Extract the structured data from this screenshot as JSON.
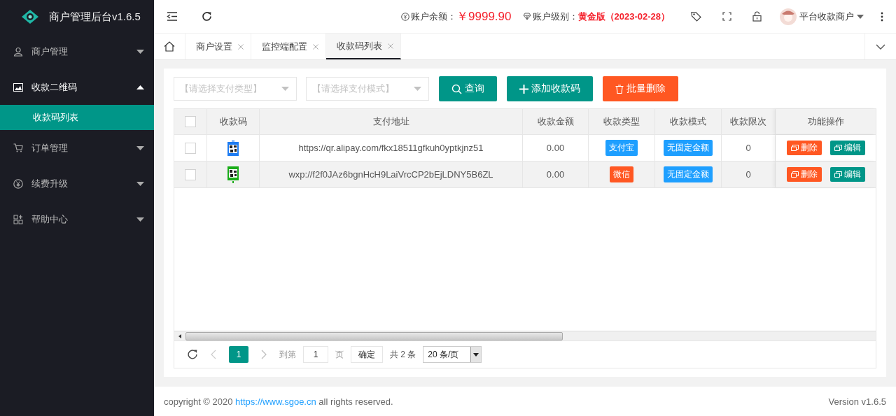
{
  "brand": {
    "title": "商户管理后台v1.6.5"
  },
  "header": {
    "balance_label": "账户余额：",
    "balance": "￥9999.90",
    "level_label": "账户级别：",
    "level": "黄金版（2023-02-28）",
    "user": "平台收款商户"
  },
  "sidebar": {
    "items": [
      {
        "label": "商户管理",
        "expanded": false
      },
      {
        "label": "收款二维码",
        "expanded": true,
        "children": [
          {
            "label": "收款码列表",
            "selected": true
          }
        ]
      },
      {
        "label": "订单管理",
        "expanded": false
      },
      {
        "label": "续费升级",
        "expanded": false
      },
      {
        "label": "帮助中心",
        "expanded": false
      }
    ]
  },
  "tabs": [
    {
      "label": "商户设置",
      "selected": false
    },
    {
      "label": "监控端配置",
      "selected": false
    },
    {
      "label": "收款码列表",
      "selected": true
    }
  ],
  "filters": {
    "pay_type_placeholder": "【请选择支付类型】",
    "pay_mode_placeholder": "【请选择支付模式】",
    "search": "查询",
    "add": "添加收款码",
    "batch_delete": "批量删除"
  },
  "table": {
    "select_all_checked": false,
    "columns": [
      "收款码",
      "支付地址",
      "收款金额",
      "收款类型",
      "收款模式",
      "收款限次",
      "功能操作"
    ],
    "rows": [
      {
        "checked": false,
        "kind": "alipay",
        "address": "https://qr.alipay.com/fkx18511gfkuh0yptkjnz51",
        "amount": "0.00",
        "type": {
          "label": "支付宝",
          "color": "#1e9fff"
        },
        "mode": "无固定金额",
        "limit": "0",
        "delete": "删除",
        "edit": "编辑"
      },
      {
        "checked": false,
        "kind": "wechat",
        "address": "wxp://f2f0JAz6bgnHcH9LaiVrcCP2bEjLDNY5B6ZL",
        "amount": "0.00",
        "type": {
          "label": "微信",
          "color": "#ff5722"
        },
        "mode": "无固定金额",
        "limit": "0",
        "delete": "删除",
        "edit": "编辑"
      }
    ]
  },
  "pagination": {
    "pages": [
      {
        "label": "1",
        "selected": true
      }
    ],
    "goto_label": "到第",
    "goto_value": "1",
    "page_unit": "页",
    "confirm": "确定",
    "total": "共 2 条",
    "page_size": "20 条/页"
  },
  "footer": {
    "copyright_before": "copyright © 2020 ",
    "link": "https://www.sgoe.cn",
    "copyright_after": " all rights reserved.",
    "version": "Version v1.6.5"
  }
}
